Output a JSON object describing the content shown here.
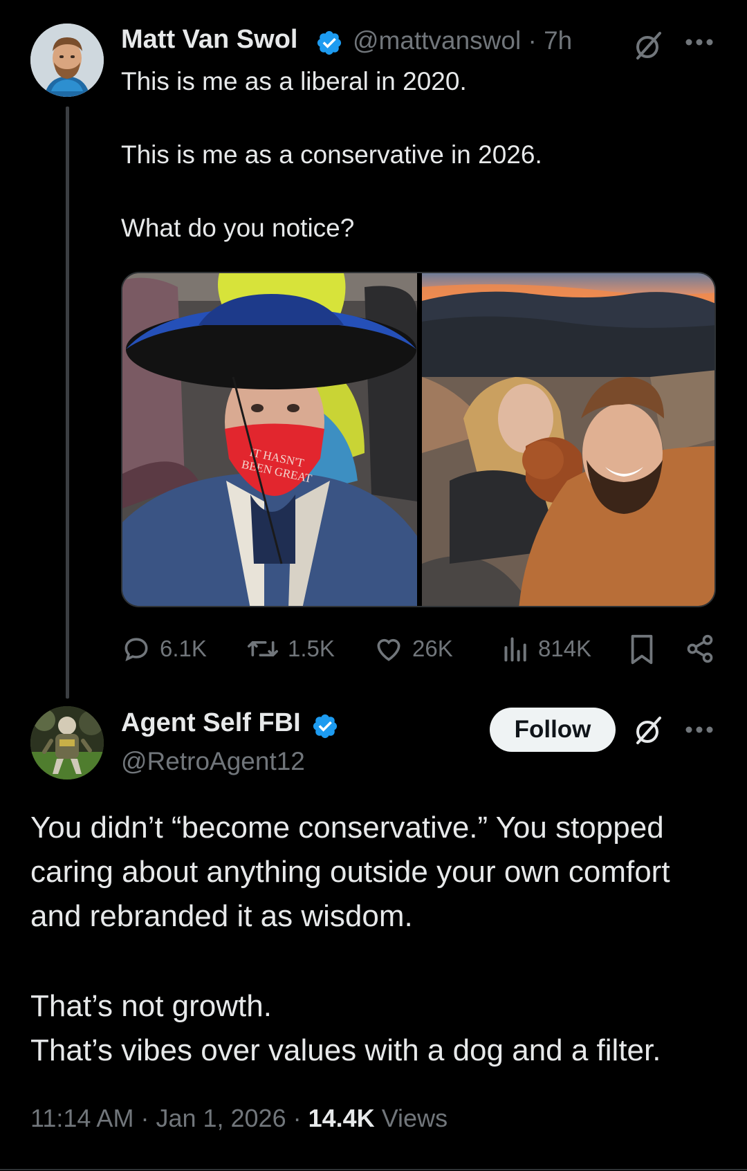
{
  "colors": {
    "background": "#000000",
    "text_primary": "#e7e9ea",
    "text_secondary": "#71767b",
    "verified_badge": "#1d9bf0",
    "follow_button_bg": "#eff3f4"
  },
  "parent_tweet": {
    "author": {
      "name": "Matt Van Swol",
      "handle": "@mattvanswol",
      "verified": true,
      "avatar_icon": "profile-photo"
    },
    "time": "7h",
    "text_lines": [
      "This is me as a liberal in 2020.",
      "This is me as a conservative in 2026.",
      "What do you notice?"
    ],
    "media": {
      "left_photo": {
        "mask_text_line1": "IT HASN'T",
        "mask_text_line2": "BEEN GREAT"
      },
      "right_photo": {}
    },
    "actions": {
      "replies": "6.1K",
      "reposts": "1.5K",
      "likes": "26K",
      "views": "814K"
    },
    "icons": [
      "grok-icon",
      "more-icon",
      "reply-icon",
      "repost-icon",
      "like-icon",
      "views-icon",
      "bookmark-icon",
      "share-icon"
    ]
  },
  "reply": {
    "author": {
      "name": "Agent Self FBI",
      "handle": "@RetroAgent12",
      "verified": true
    },
    "follow_label": "Follow",
    "text_para1": "You didn’t “become conservative.” You stopped caring about anything outside your own comfort and rebranded it as wisdom.",
    "text_para2_line1": "That’s not growth.",
    "text_para2_line2": "That’s vibes over values with a dog and a filter.",
    "meta": {
      "time": "11:14 AM",
      "date": "Jan 1, 2026",
      "separator": " · ",
      "views_count": "14.4K",
      "views_label": "Views"
    }
  }
}
